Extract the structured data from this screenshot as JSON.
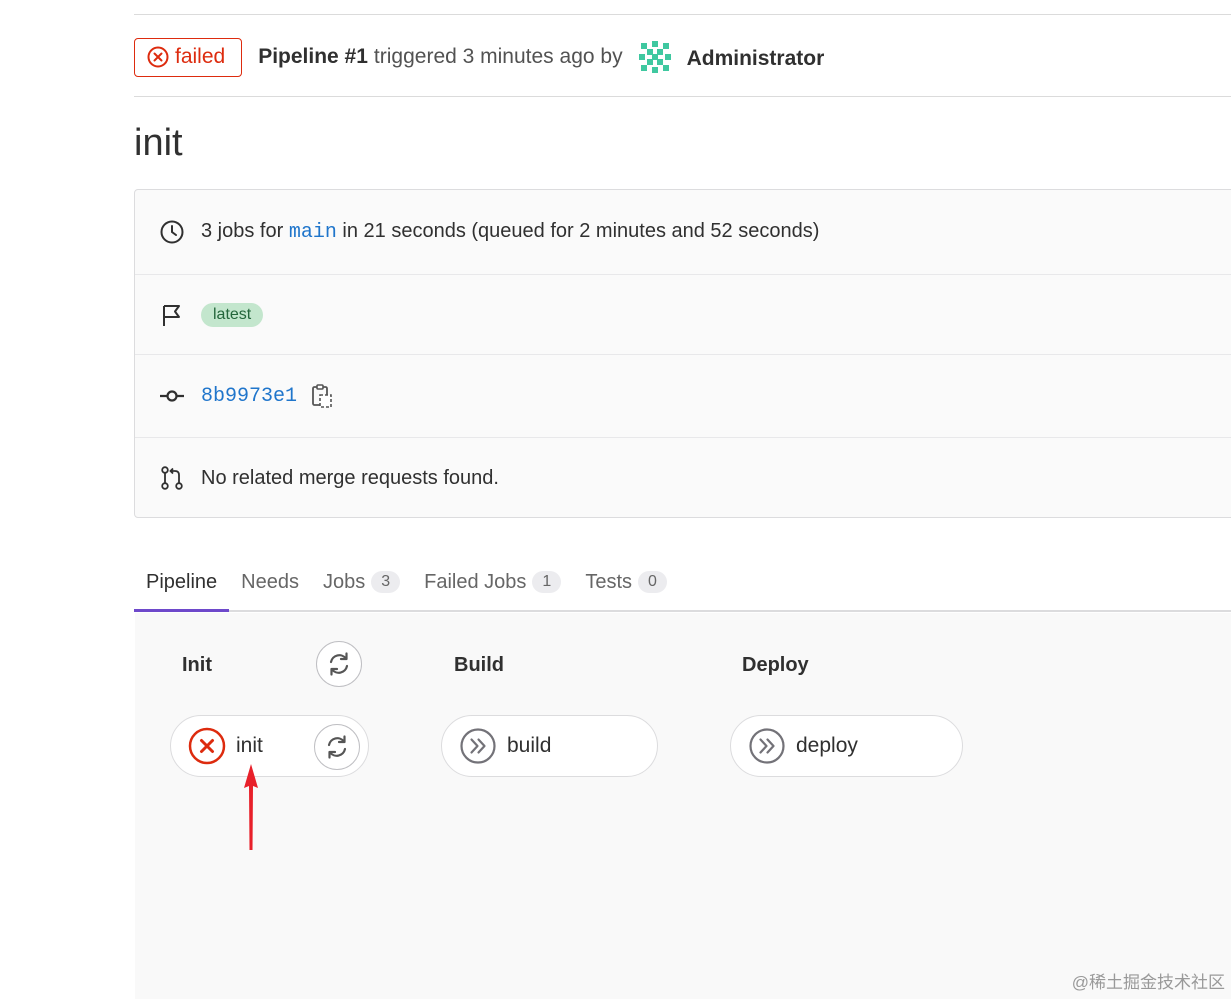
{
  "header": {
    "status_label": "failed",
    "pipeline_id": "Pipeline #1",
    "triggered_text": "triggered 3 minutes ago by",
    "user_name": "Administrator"
  },
  "commit": {
    "title": "init"
  },
  "info": {
    "jobs_prefix": "3 jobs for",
    "branch": "main",
    "jobs_suffix": "in 21 seconds (queued for 2 minutes and 52 seconds)",
    "badge": "latest",
    "sha": "8b9973e1",
    "merge_requests": "No related merge requests found."
  },
  "tabs": [
    {
      "label": "Pipeline",
      "count": ""
    },
    {
      "label": "Needs",
      "count": ""
    },
    {
      "label": "Jobs",
      "count": "3"
    },
    {
      "label": "Failed Jobs",
      "count": "1"
    },
    {
      "label": "Tests",
      "count": "0"
    }
  ],
  "stages": [
    {
      "name": "Init",
      "job": "init",
      "job_status": "failed"
    },
    {
      "name": "Build",
      "job": "build",
      "job_status": "skipped"
    },
    {
      "name": "Deploy",
      "job": "deploy",
      "job_status": "skipped"
    }
  ],
  "colors": {
    "failed": "#dd2b0e",
    "link": "#1f75cb",
    "active_tab": "#6e49cb",
    "badge_bg": "#c3e6cd",
    "arrow": "#e8202a"
  },
  "watermark": "@稀土掘金技术社区"
}
